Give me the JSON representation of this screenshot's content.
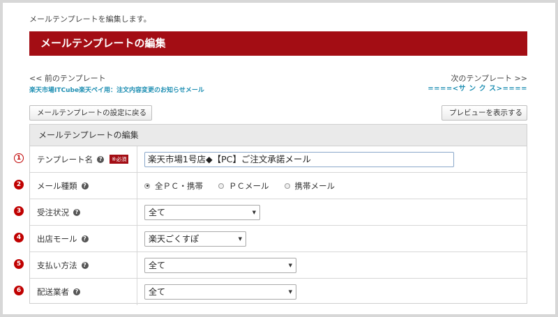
{
  "header": {
    "note": "メールテンプレートを編集します。",
    "title": "メールテンプレートの編集"
  },
  "nav": {
    "prev_label": "<< 前のテンプレート",
    "prev_name": "楽天市場ITCube楽天ペイ用：注文内容変更のお知らせメール",
    "next_label": "次のテンプレート >>",
    "next_name": "====<サ ン ク ス>===="
  },
  "buttons": {
    "back": "メールテンプレートの設定に戻る",
    "preview": "プレビューを表示する"
  },
  "form": {
    "heading": "メールテンプレートの編集",
    "required_badge": "※必須",
    "help_glyph": "?",
    "rows": {
      "template_name": {
        "marker": "1",
        "label": "テンプレート名",
        "value": "楽天市場1号店◆【PC】ご注文承諾メール"
      },
      "mail_type": {
        "marker": "2",
        "label": "メール種類",
        "options": [
          "全ＰＣ・携帯",
          "ＰＣメール",
          "携帯メール"
        ],
        "selected": 0
      },
      "order_status": {
        "marker": "3",
        "label": "受注状況",
        "value": "全て"
      },
      "store_mall": {
        "marker": "4",
        "label": "出店モール",
        "value": "楽天ごくすぽ"
      },
      "payment_method": {
        "marker": "5",
        "label": "支払い方法",
        "value": "全て"
      },
      "shipping_carrier": {
        "marker": "6",
        "label": "配送業者",
        "value": "全て"
      }
    }
  },
  "colors": {
    "title_bar": "#a30d14",
    "link": "#1f8fb3",
    "marker": "#c00000"
  }
}
